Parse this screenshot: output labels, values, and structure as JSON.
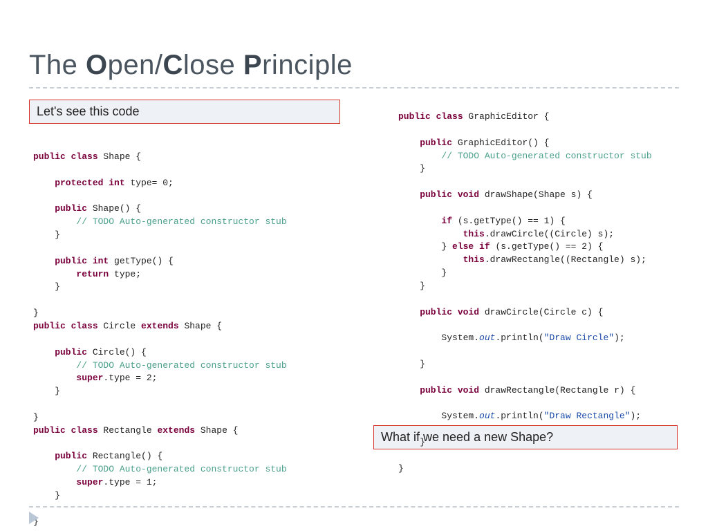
{
  "title": {
    "pre1": "The ",
    "b1": "O",
    "mid1": "pen/",
    "b2": "C",
    "mid2": "lose ",
    "b3": "P",
    "post": "rinciple"
  },
  "callouts": {
    "top": "Let's see this code",
    "bottom": "What if we need a new Shape?"
  },
  "code_left": {
    "l01a": "public",
    "l01b": " class",
    "l01c": " Shape {",
    "l02": "",
    "l03a": "    protected",
    "l03b": " int",
    "l03c": " type= 0;",
    "l04": "",
    "l05a": "    public",
    "l05b": " Shape() {",
    "l06": "        // TODO Auto-generated constructor stub",
    "l07": "    }",
    "l08": "",
    "l09a": "    public",
    "l09b": " int",
    "l09c": " getType() {",
    "l10a": "        return",
    "l10b": " type;",
    "l11": "    }",
    "l12": "",
    "l13": "}",
    "l14a": "public",
    "l14b": " class",
    "l14c": " Circle ",
    "l14d": "extends",
    "l14e": " Shape {",
    "l15": "",
    "l16a": "    public",
    "l16b": " Circle() {",
    "l17": "        // TODO Auto-generated constructor stub",
    "l18a": "        super",
    "l18b": ".type = 2;",
    "l19": "    }",
    "l20": "",
    "l21": "}",
    "l22a": "public",
    "l22b": " class",
    "l22c": " Rectangle ",
    "l22d": "extends",
    "l22e": " Shape {",
    "l23": "",
    "l24a": "    public",
    "l24b": " Rectangle() {",
    "l25": "        // TODO Auto-generated constructor stub",
    "l26a": "        super",
    "l26b": ".type = 1;",
    "l27": "    }",
    "l28": "",
    "l29": "}"
  },
  "code_right": {
    "r01a": "public",
    "r01b": " class",
    "r01c": " GraphicEditor {",
    "r02": "",
    "r03a": "    public",
    "r03b": " GraphicEditor() {",
    "r04": "        // TODO Auto-generated constructor stub",
    "r05": "    }",
    "r06": "",
    "r07a": "    public",
    "r07b": " void",
    "r07c": " drawShape(Shape s) {",
    "r08": "",
    "r09a": "        if",
    "r09b": " (s.getType() == 1) {",
    "r10a": "            this",
    "r10b": ".drawCircle((Circle) s);",
    "r11a": "        } ",
    "r11b": "else",
    "r11c": " if",
    "r11d": " (s.getType() == 2) {",
    "r12a": "            this",
    "r12b": ".drawRectangle((Rectangle) s);",
    "r13": "        }",
    "r14": "    }",
    "r15": "",
    "r16a": "    public",
    "r16b": " void",
    "r16c": " drawCircle(Circle c) {",
    "r17": "",
    "r18a": "        System.",
    "r18b": "out",
    "r18c": ".println(",
    "r18d": "\"Draw Circle\"",
    "r18e": ");",
    "r19": "",
    "r20": "    }",
    "r21": "",
    "r22a": "    public",
    "r22b": " void",
    "r22c": " drawRectangle(Rectangle r) {",
    "r23": "",
    "r24a": "        System.",
    "r24b": "out",
    "r24c": ".println(",
    "r24d": "\"Draw Rectangle\"",
    "r24e": ");",
    "r25": "",
    "r26": "    }",
    "r27": "",
    "r28": "}"
  }
}
